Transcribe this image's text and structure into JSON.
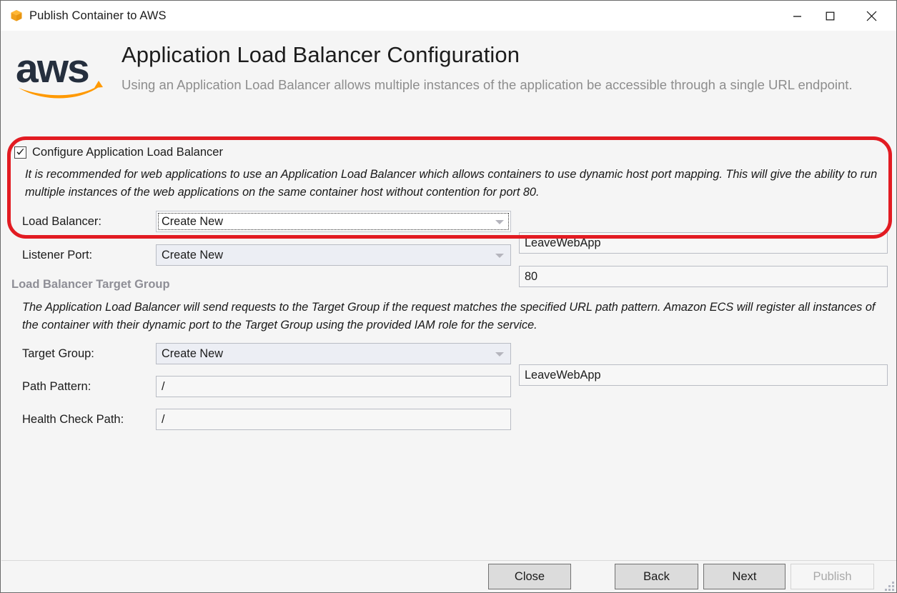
{
  "window": {
    "title": "Publish Container to AWS",
    "title_icon": "package-box-icon",
    "controls": {
      "minimize": "minimize-icon",
      "maximize": "maximize-icon",
      "close": "close-icon"
    }
  },
  "header": {
    "logo": "aws-logo",
    "title": "Application Load Balancer Configuration",
    "subtitle": "Using an Application Load Balancer allows multiple instances of the application be accessible through a single URL endpoint."
  },
  "main": {
    "configure_checkbox": {
      "label": "Configure Application Load Balancer",
      "checked": true
    },
    "load_balancer_note": "It is recommended for web applications to use an Application Load Balancer which allows containers to use dynamic host port mapping. This will give the ability to run multiple instances of the web applications on the same container host without contention for port 80.",
    "rows": {
      "load_balancer": {
        "label": "Load Balancer:",
        "combo_value": "Create New",
        "text_value": "LeaveWebApp"
      },
      "listener_port": {
        "label": "Listener Port:",
        "combo_value": "Create New",
        "text_value": "80"
      },
      "target_group": {
        "label": "Target Group:",
        "combo_value": "Create New",
        "text_value": "LeaveWebApp"
      },
      "path_pattern": {
        "label": "Path Pattern:",
        "text_value": "/"
      },
      "health_check_path": {
        "label": "Health Check Path:",
        "text_value": "/"
      }
    },
    "target_group_section": {
      "heading": "Load Balancer Target Group",
      "note": "The Application Load Balancer will send requests to the Target Group if the request matches the specified URL path pattern. Amazon ECS will register all instances of the container with their dynamic port to the Target Group using the provided IAM role for the service."
    },
    "annotation": {
      "shape": "red-rounded-rectangle-highlight",
      "color": "#e21b22"
    }
  },
  "footer": {
    "close_label": "Close",
    "back_label": "Back",
    "next_label": "Next",
    "publish_label": "Publish",
    "publish_disabled": true
  },
  "colors": {
    "aws_orange": "#ff9900",
    "aws_dark": "#252f3e",
    "annotation_red": "#e21b22",
    "muted_text": "#8d8d8d"
  }
}
